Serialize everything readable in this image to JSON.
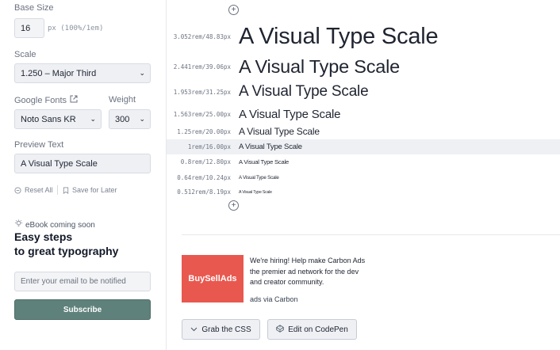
{
  "sidebar": {
    "base_size": {
      "label": "Base Size",
      "value": "16",
      "unit": "px (100%/1em)"
    },
    "scale": {
      "label": "Scale",
      "selected": "1.250 – Major Third"
    },
    "google_fonts": {
      "label": "Google Fonts",
      "selected": "Noto Sans KR"
    },
    "weight": {
      "label": "Weight",
      "selected": "300"
    },
    "preview_text": {
      "label": "Preview Text",
      "value": "A Visual Type Scale"
    },
    "reset_all": "Reset All",
    "save_for_later": "Save for Later",
    "ebook": {
      "tag": "eBook coming soon",
      "heading_line1": "Easy steps",
      "heading_line2": "to great typography",
      "email_placeholder": "Enter your email to be notified",
      "subscribe": "Subscribe"
    }
  },
  "scale_rows": [
    {
      "size": "3.052rem/48.83px",
      "text": "A Visual Type Scale"
    },
    {
      "size": "2.441rem/39.06px",
      "text": "A Visual Type Scale"
    },
    {
      "size": "1.953rem/31.25px",
      "text": "A Visual Type Scale"
    },
    {
      "size": "1.563rem/25.00px",
      "text": "A Visual Type Scale"
    },
    {
      "size": "1.25rem/20.00px",
      "text": "A Visual Type Scale"
    },
    {
      "size": "1rem/16.00px",
      "text": "A Visual Type Scale"
    },
    {
      "size": "0.8rem/12.80px",
      "text": "A Visual Type Scale"
    },
    {
      "size": "0.64rem/10.24px",
      "text": "A Visual Type Scale"
    },
    {
      "size": "0.512rem/8.19px",
      "text": "A Visual Type Scale"
    }
  ],
  "ad": {
    "brand": "BuySellAds",
    "text": "We're hiring! Help make Carbon Ads the premier ad network for the dev and creator community.",
    "via": "ads via Carbon"
  },
  "actions": {
    "grab_css": "Grab the CSS",
    "edit_codepen": "Edit on CodePen"
  },
  "icons": {
    "add_step": "plus-circle-icon",
    "external": "external-link-icon",
    "reset": "reset-icon",
    "bookmark": "bookmark-icon",
    "bulb": "lightbulb-icon",
    "chevron": "chevron-down-icon",
    "codepen": "codepen-icon"
  },
  "colors": {
    "accent": "#5f817b",
    "ad_bg": "#e8584f",
    "highlight_row": "#eef0f4"
  }
}
